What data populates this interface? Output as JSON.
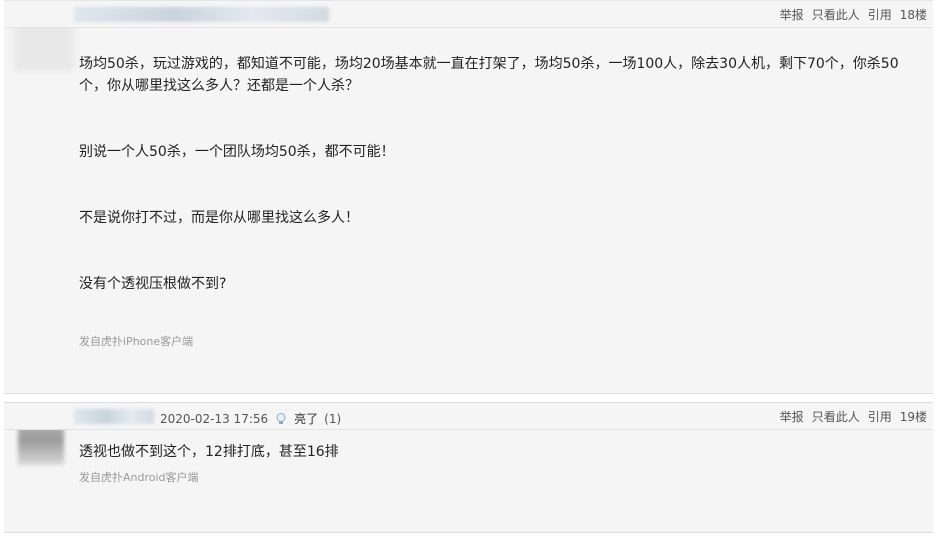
{
  "posts": [
    {
      "floor": "18楼",
      "actions": [
        "举报",
        "只看此人",
        "引用"
      ],
      "paragraphs": [
        "场均50杀，玩过游戏的，都知道不可能，场均20场基本就一直在打架了，场均50杀，一场100人，除去30人机，剩下70个，你杀50个，你从哪里找这么多人？还都是一个人杀？",
        "别说一个人50杀，一个团队场均50杀，都不可能！",
        "不是说你打不过，而是你从哪里找这么多人！",
        "没有个透视压根做不到?"
      ],
      "source": "发自虎扑iPhone客户端"
    },
    {
      "floor": "19楼",
      "actions": [
        "举报",
        "只看此人",
        "引用"
      ],
      "date": "2020-02-13 17:56",
      "light_label": "亮了",
      "light_count": "(1)",
      "paragraphs": [
        "透视也做不到这个，12排打底，甚至16排"
      ],
      "source": "发自虎扑Android客户端"
    }
  ],
  "colors": {
    "background": "#f5f5f5",
    "text": "#222222",
    "muted": "#999999"
  },
  "icons": {
    "light": "lightbulb-icon"
  }
}
